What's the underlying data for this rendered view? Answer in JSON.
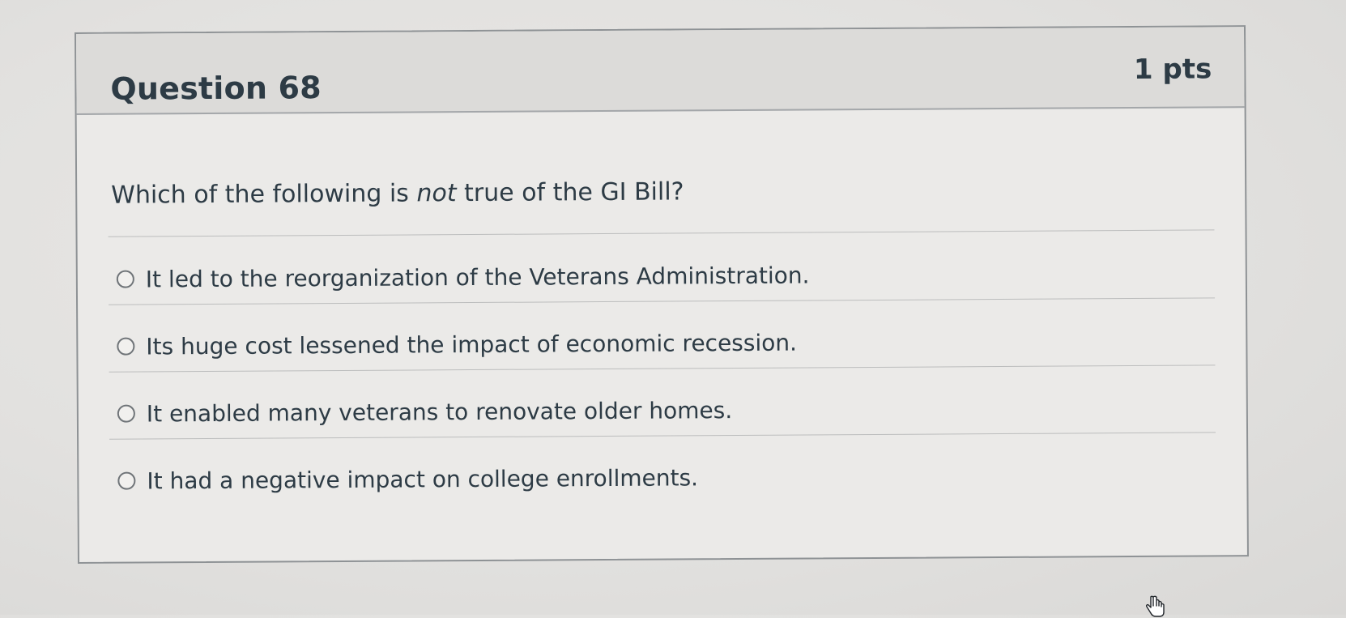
{
  "question": {
    "title": "Question 68",
    "points": "1 pts",
    "text_before": "Which of the following is ",
    "text_emphasis": "not",
    "text_after": " true of the GI Bill?"
  },
  "answers": [
    {
      "label": "It led to the reorganization of the Veterans Administration."
    },
    {
      "label": "Its huge cost lessened the impact of economic recession."
    },
    {
      "label": "It enabled many veterans to renovate older homes."
    },
    {
      "label": "It had a negative impact on college enrollments."
    }
  ],
  "icons": {
    "radio": "radio-unselected-icon",
    "cursor": "hand-pointer-icon"
  }
}
